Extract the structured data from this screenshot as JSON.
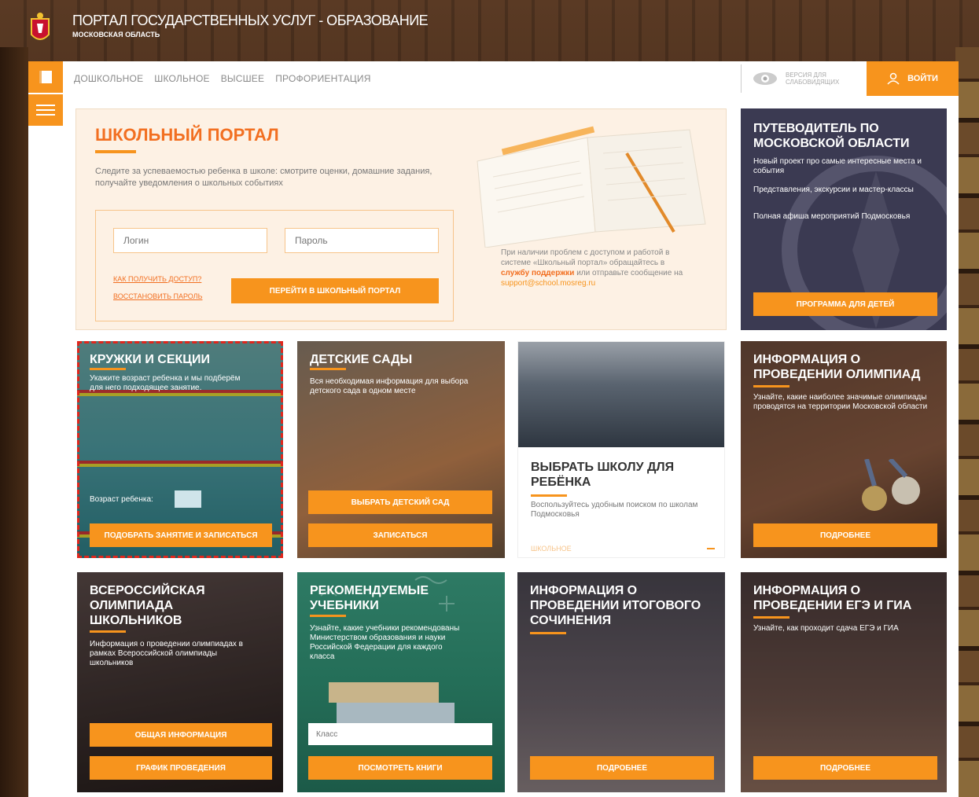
{
  "header": {
    "title": "ПОРТАЛ ГОСУДАРСТВЕННЫХ УСЛУГ - ОБРАЗОВАНИЕ",
    "subtitle": "МОСКОВСКАЯ ОБЛАСТЬ"
  },
  "nav": {
    "items": [
      "ДОШКОЛЬНОЕ",
      "ШКОЛЬНОЕ",
      "ВЫСШЕЕ",
      "ПРОФОРИЕНТАЦИЯ"
    ],
    "vision_label": "ВЕРСИЯ ДЛЯ СЛАБОВИДЯЩИХ",
    "login_label": "ВОЙТИ"
  },
  "school_portal": {
    "title": "ШКОЛЬНЫЙ ПОРТАЛ",
    "description": "Следите за успеваемостью ребенка в школе: смотрите оценки, домашние задания, получайте уведомления о школьных событиях",
    "login_placeholder": "Логин",
    "password_placeholder": "Пароль",
    "how_access": "КАК ПОЛУЧИТЬ ДОСТУП?",
    "restore_password": "ВОССТАНОВИТЬ ПАРОЛЬ",
    "go_button": "ПЕРЕЙТИ В ШКОЛЬНЫЙ ПОРТАЛ",
    "support_text_1": "При наличии проблем с доступом и работой в системе «Школьный портал» обращайтесь в",
    "support_link": "службу поддержки",
    "support_text_2": "или отправьте сообщение на",
    "support_email": "support@school.mosreg.ru"
  },
  "guide": {
    "title": "ПУТЕВОДИТЕЛЬ ПО МОСКОВСКОЙ ОБЛАСТИ",
    "items": [
      "Новый проект про самые интересные места и события",
      "Представления, экскурсии и мастер-классы",
      "Полная афиша мероприятий Подмосковья"
    ],
    "button": "ПРОГРАММА ДЛЯ ДЕТЕЙ"
  },
  "kruzhki": {
    "title": "КРУЖКИ И СЕКЦИИ",
    "description": "Укажите возраст ребенка и мы подберём для него подходящее занятие.",
    "age_label": "Возраст ребенка:",
    "button": "ПОДОБРАТЬ ЗАНЯТИЕ И ЗАПИСАТЬСЯ"
  },
  "sady": {
    "title": "ДЕТСКИЕ САДЫ",
    "description": "Вся необходимая информация для выбора детского сада в одном месте",
    "button1": "ВЫБРАТЬ ДЕТСКИЙ САД",
    "button2": "ЗАПИСАТЬСЯ"
  },
  "shkola": {
    "title": "ВЫБРАТЬ ШКОЛУ ДЛЯ РЕБЁНКА",
    "description": "Воспользуйтесь удобным поиском по школам Подмосковья",
    "tag": "ШКОЛЬНОЕ"
  },
  "olimpiady": {
    "title": "ИНФОРМАЦИЯ О ПРОВЕДЕНИИ ОЛИМПИАД",
    "description": "Узнайте, какие наиболее значимые олимпиады проводятся на территории Московской области",
    "button": "ПОДРОБНЕЕ"
  },
  "vseros": {
    "title": "ВСЕРОССИЙСКАЯ ОЛИМПИАДА ШКОЛЬНИКОВ",
    "description": "Информация о проведении олимпиадах в рамках Всероссийской олимпиады школьников",
    "button1": "ОБЩАЯ ИНФОРМАЦИЯ",
    "button2": "ГРАФИК ПРОВЕДЕНИЯ"
  },
  "uchebniki": {
    "title": "РЕКОМЕНДУЕМЫЕ УЧЕБНИКИ",
    "description": "Узнайте, какие учебники рекомендованы Министерством образования и науки Российской Федерации для каждого класса",
    "class_placeholder": "Класс",
    "button": "ПОСМОТРЕТЬ КНИГИ"
  },
  "sochinenie": {
    "title": "ИНФОРМАЦИЯ О ПРОВЕДЕНИИ ИТОГОВОГО СОЧИНЕНИЯ",
    "button": "ПОДРОБНЕЕ"
  },
  "ege": {
    "title": "ИНФОРМАЦИЯ О ПРОВЕДЕНИИ ЕГЭ И ГИА",
    "description": "Узнайте, как проходит сдача ЕГЭ и ГИА",
    "button": "ПОДРОБНЕЕ"
  },
  "colors": {
    "accent": "#f7941d",
    "accent_dark": "#f26f21",
    "highlight": "#e0261c"
  }
}
